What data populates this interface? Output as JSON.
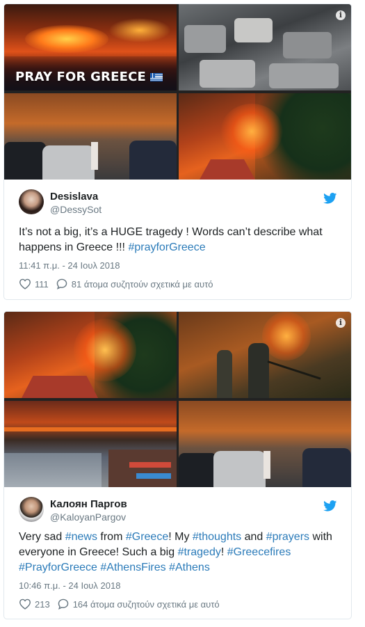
{
  "tweets": [
    {
      "display_name": "Desislava",
      "handle": "@DessySot",
      "text_parts": [
        {
          "t": "It’s not a big, it’s a HUGE tragedy ! Words can’t describe what happens in Greece !!! ",
          "tag": false
        },
        {
          "t": "#prayforGreece",
          "tag": true
        }
      ],
      "timestamp": "11:41 π.μ. - 24 Ιουλ 2018",
      "likes": "111",
      "replies": "81 άτομα συζητούν σχετικά με αυτό",
      "overlay_text": "PRAY FOR GREECE",
      "info_icon": "i"
    },
    {
      "display_name": "Калоян Паргов",
      "handle": "@KaloyanPargov",
      "text_parts": [
        {
          "t": "Very sad ",
          "tag": false
        },
        {
          "t": "#news",
          "tag": true
        },
        {
          "t": " from ",
          "tag": false
        },
        {
          "t": "#Greece",
          "tag": true
        },
        {
          "t": "! My ",
          "tag": false
        },
        {
          "t": "#thoughts",
          "tag": true
        },
        {
          "t": " and ",
          "tag": false
        },
        {
          "t": "#prayers",
          "tag": true
        },
        {
          "t": " with everyone in Greece! Such a big ",
          "tag": false
        },
        {
          "t": "#tragedy",
          "tag": true
        },
        {
          "t": "! ",
          "tag": false
        },
        {
          "t": "#Greecefires",
          "tag": true
        },
        {
          "t": " ",
          "tag": false
        },
        {
          "t": "#PrayforGreece",
          "tag": true
        },
        {
          "t": " ",
          "tag": false
        },
        {
          "t": "#AthensFires",
          "tag": true
        },
        {
          "t": " ",
          "tag": false
        },
        {
          "t": "#Athens",
          "tag": true
        }
      ],
      "timestamp": "10:46 π.μ. - 24 Ιουλ 2018",
      "likes": "213",
      "replies": "164 άτομα συζητούν σχετικά με αυτό",
      "info_icon": "i"
    }
  ],
  "colors": {
    "hashtag": "#2b7bb9",
    "twitter_bird": "#1da1f2",
    "muted": "#697882",
    "border": "#e1e8ed"
  },
  "icons": [
    "info-icon",
    "twitter-bird-icon",
    "heart-icon",
    "reply-bubble-icon",
    "greek-flag-icon"
  ]
}
